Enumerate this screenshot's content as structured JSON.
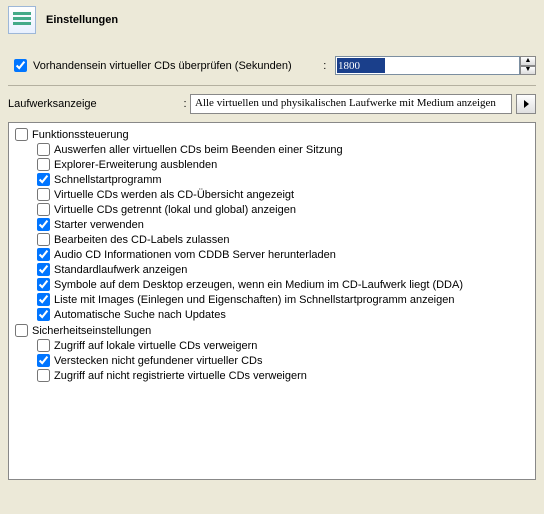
{
  "header": {
    "title": "Einstellungen"
  },
  "verify": {
    "checked": true,
    "label": "Vorhandensein virtueller CDs überprüfen (Sekunden)",
    "value": "1800"
  },
  "driveDisplay": {
    "label": "Laufwerksanzeige",
    "selected": "Alle virtuellen und physikalischen Laufwerke mit Medium anzeigen"
  },
  "groups": [
    {
      "name": "funktionssteuerung",
      "label": "Funktionssteuerung",
      "checked": false,
      "items": [
        {
          "label": "Auswerfen aller virtuellen CDs beim Beenden einer Sitzung",
          "checked": false
        },
        {
          "label": "Explorer-Erweiterung ausblenden",
          "checked": false
        },
        {
          "label": "Schnellstartprogramm",
          "checked": true
        },
        {
          "label": "Virtuelle CDs werden als CD-Übersicht angezeigt",
          "checked": false
        },
        {
          "label": "Virtuelle CDs getrennt (lokal und global) anzeigen",
          "checked": false
        },
        {
          "label": "Starter verwenden",
          "checked": true
        },
        {
          "label": "Bearbeiten des CD-Labels zulassen",
          "checked": false
        },
        {
          "label": "Audio CD Informationen vom CDDB Server herunterladen",
          "checked": true
        },
        {
          "label": "Standardlaufwerk anzeigen",
          "checked": true
        },
        {
          "label": "Symbole auf dem Desktop erzeugen, wenn ein Medium im CD-Laufwerk liegt (DDA)",
          "checked": true
        },
        {
          "label": "Liste mit Images (Einlegen und Eigenschaften) im Schnellstartprogramm anzeigen",
          "checked": true
        },
        {
          "label": "Automatische Suche nach Updates",
          "checked": true
        }
      ]
    },
    {
      "name": "sicherheitseinstellungen",
      "label": "Sicherheitseinstellungen",
      "checked": false,
      "items": [
        {
          "label": "Zugriff auf lokale virtuelle CDs verweigern",
          "checked": false
        },
        {
          "label": "Verstecken nicht gefundener virtueller CDs",
          "checked": true
        },
        {
          "label": "Zugriff auf nicht registrierte virtuelle CDs verweigern",
          "checked": false
        }
      ]
    }
  ]
}
